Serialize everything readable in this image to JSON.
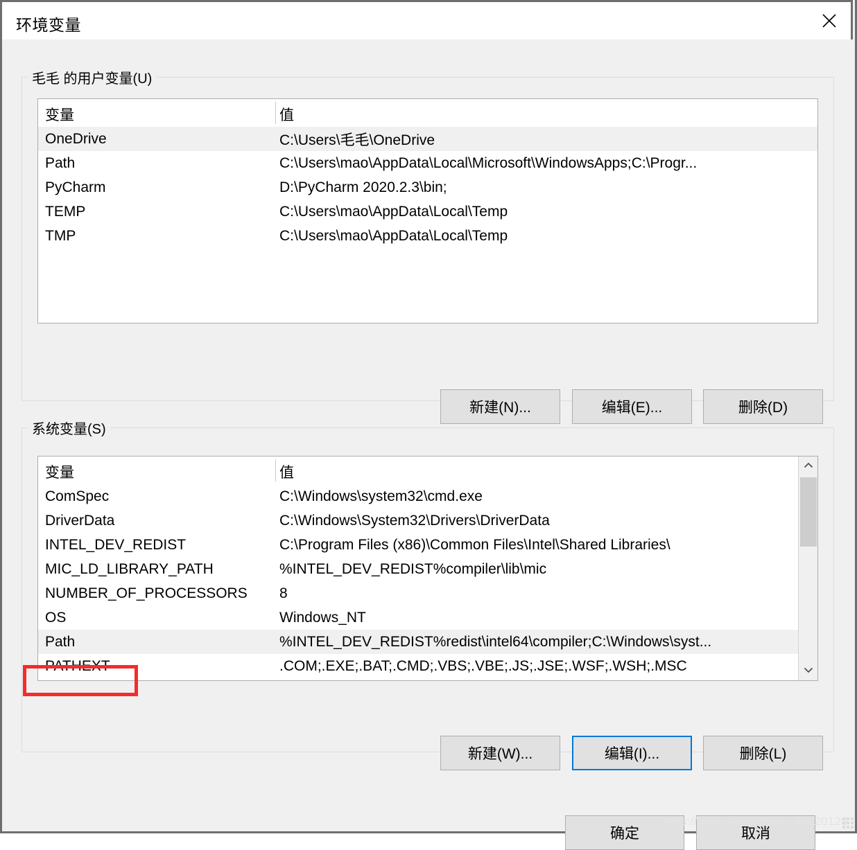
{
  "window": {
    "title": "环境变量",
    "close_icon": "close-icon"
  },
  "user_section": {
    "legend": "毛毛 的用户变量(U)",
    "columns": {
      "variable": "变量",
      "value": "值"
    },
    "rows": [
      {
        "variable": "OneDrive",
        "value": "C:\\Users\\毛毛\\OneDrive",
        "selected": true
      },
      {
        "variable": "Path",
        "value": "C:\\Users\\mao\\AppData\\Local\\Microsoft\\WindowsApps;C:\\Progr...",
        "selected": false
      },
      {
        "variable": "PyCharm",
        "value": "D:\\PyCharm 2020.2.3\\bin;",
        "selected": false
      },
      {
        "variable": "TEMP",
        "value": "C:\\Users\\mao\\AppData\\Local\\Temp",
        "selected": false
      },
      {
        "variable": "TMP",
        "value": "C:\\Users\\mao\\AppData\\Local\\Temp",
        "selected": false
      }
    ],
    "buttons": {
      "new": "新建(N)...",
      "edit": "编辑(E)...",
      "delete": "删除(D)"
    }
  },
  "system_section": {
    "legend": "系统变量(S)",
    "columns": {
      "variable": "变量",
      "value": "值"
    },
    "rows": [
      {
        "variable": "ComSpec",
        "value": "C:\\Windows\\system32\\cmd.exe",
        "selected": false
      },
      {
        "variable": "DriverData",
        "value": "C:\\Windows\\System32\\Drivers\\DriverData",
        "selected": false
      },
      {
        "variable": "INTEL_DEV_REDIST",
        "value": "C:\\Program Files (x86)\\Common Files\\Intel\\Shared Libraries\\",
        "selected": false
      },
      {
        "variable": "MIC_LD_LIBRARY_PATH",
        "value": "%INTEL_DEV_REDIST%compiler\\lib\\mic",
        "selected": false
      },
      {
        "variable": "NUMBER_OF_PROCESSORS",
        "value": "8",
        "selected": false
      },
      {
        "variable": "OS",
        "value": "Windows_NT",
        "selected": false
      },
      {
        "variable": "Path",
        "value": "%INTEL_DEV_REDIST%redist\\intel64\\compiler;C:\\Windows\\syst...",
        "selected": true
      },
      {
        "variable": "PATHEXT",
        "value": ".COM;.EXE;.BAT;.CMD;.VBS;.VBE;.JS;.JSE;.WSF;.WSH;.MSC",
        "selected": false
      }
    ],
    "buttons": {
      "new": "新建(W)...",
      "edit": "编辑(I)...",
      "delete": "删除(L)"
    },
    "scrollbar": {
      "up_icon": "chevron-up-icon",
      "down_icon": "chevron-down-icon"
    }
  },
  "dialog_buttons": {
    "ok": "确定",
    "cancel": "取消"
  },
  "annotation": {
    "target": "Path",
    "color": "#f42c2c"
  },
  "watermark": {
    "text": "https://blog.csdn.net/qq_46620129"
  },
  "colors": {
    "dialog_bg": "#f0f0f0",
    "titlebar_bg": "#ffffff",
    "list_bg": "#ffffff",
    "row_selected_bg": "#f0f0f0",
    "button_bg": "#e1e1e1",
    "button_border": "#adadad",
    "focus_border": "#0078d7",
    "window_border": "#6e6e6e",
    "annotation_red": "#f42c2c"
  }
}
